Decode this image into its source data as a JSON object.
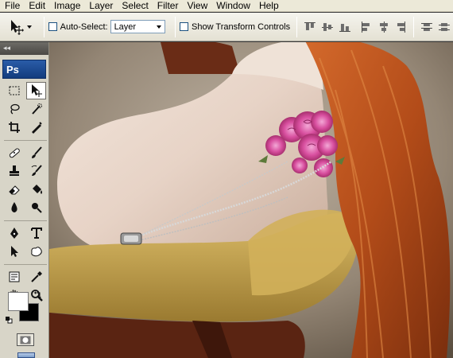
{
  "menu": [
    "File",
    "Edit",
    "Image",
    "Layer",
    "Select",
    "Filter",
    "View",
    "Window",
    "Help"
  ],
  "options": {
    "auto_select_label": "Auto-Select:",
    "auto_select_value": "Layer",
    "show_transform_label": "Show Transform Controls"
  },
  "toolbox": {
    "collapse_glyph": "◂◂",
    "logo_text": "Ps",
    "tools": [
      {
        "name": "marquee-tool-icon",
        "active": false
      },
      {
        "name": "move-tool-icon",
        "active": true
      },
      {
        "name": "lasso-tool-icon",
        "active": false
      },
      {
        "name": "quick-selection-tool-icon",
        "active": false
      },
      {
        "name": "crop-tool-icon",
        "active": false
      },
      {
        "name": "eyedropper-slice-tool-icon",
        "active": false
      },
      {
        "name": "healing-brush-tool-icon",
        "active": false
      },
      {
        "name": "brush-tool-icon",
        "active": false
      },
      {
        "name": "clone-stamp-tool-icon",
        "active": false
      },
      {
        "name": "history-brush-tool-icon",
        "active": false
      },
      {
        "name": "eraser-tool-icon",
        "active": false
      },
      {
        "name": "paint-bucket-tool-icon",
        "active": false
      },
      {
        "name": "blur-tool-icon",
        "active": false
      },
      {
        "name": "dodge-tool-icon",
        "active": false
      },
      {
        "name": "pen-tool-icon",
        "active": false
      },
      {
        "name": "type-tool-icon",
        "active": false
      },
      {
        "name": "path-selection-tool-icon",
        "active": false
      },
      {
        "name": "custom-shape-tool-icon",
        "active": false
      },
      {
        "name": "notes-tool-icon",
        "active": false
      },
      {
        "name": "eyedropper-tool-icon",
        "active": false
      },
      {
        "name": "hand-tool-icon",
        "active": false
      },
      {
        "name": "zoom-tool-icon",
        "active": false
      }
    ],
    "foreground_color": "#ffffff",
    "background_color": "#000000"
  },
  "colors": {
    "logo_blue": "#1f4f99",
    "hair": "#b5521e",
    "rose": "#d94fa0",
    "couch": "#c7a44a",
    "skin": "#e8d6cc"
  }
}
